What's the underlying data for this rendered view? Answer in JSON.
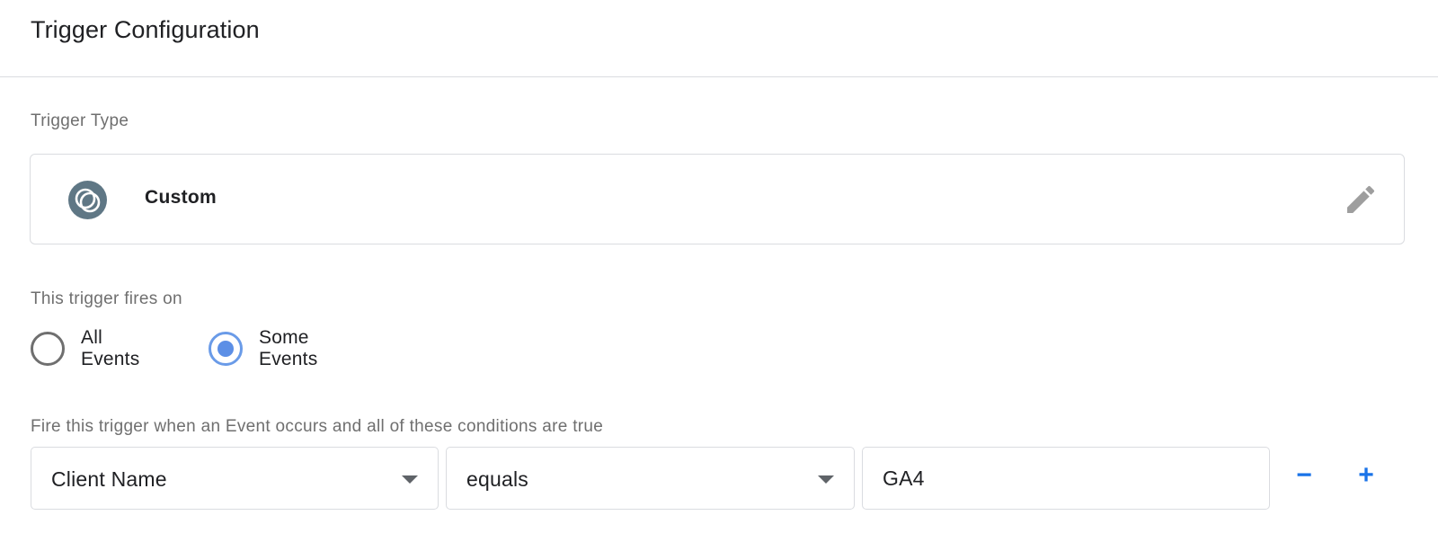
{
  "header": {
    "title": "Trigger Configuration"
  },
  "trigger_type": {
    "label": "Trigger Type",
    "value": "Custom",
    "icon": "custom-trigger-icon",
    "edit_icon": "pencil-icon"
  },
  "fires_on": {
    "label": "This trigger fires on",
    "options": [
      {
        "label": "All Events",
        "selected": false
      },
      {
        "label": "Some Events",
        "selected": true
      }
    ]
  },
  "conditions": {
    "label": "Fire this trigger when an Event occurs and all of these conditions are true",
    "variable": "Client Name",
    "operator": "equals",
    "value": "GA4",
    "remove_label": "−",
    "add_label": "+"
  },
  "colors": {
    "accent": "#1a73e8",
    "radio_selected": "#5c8fe6",
    "icon_bg": "#5f7785",
    "border": "#dadce0"
  }
}
